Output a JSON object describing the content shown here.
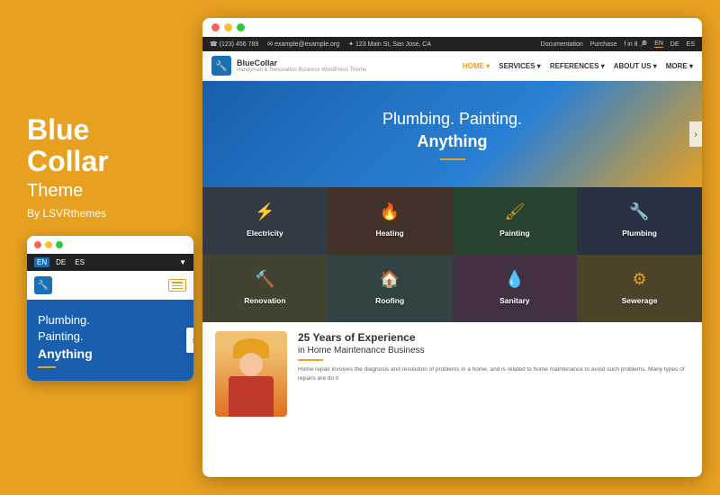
{
  "leftPanel": {
    "brandLine1": "Blue",
    "brandLine2": "Collar",
    "brandSubtitle": "Theme",
    "brandBy": "By LSVRthemes"
  },
  "mobile": {
    "heroText1": "Plumbing.",
    "heroText2": "Painting.",
    "heroText3": "Anything",
    "langTabs": [
      "EN",
      "DE",
      "ES"
    ]
  },
  "browser": {
    "topBar": {
      "phone": "☎ (123) 456 789",
      "email": "✉ example@example.org",
      "address": "✦ 123 Main St, San Jose, CA",
      "docLink": "Documentation",
      "purchaseLink": "Purchase",
      "langEN": "EN",
      "langDE": "DE",
      "langES": "ES"
    },
    "nav": {
      "logoName": "BlueCollar",
      "logoDesc": "Handyman & Renovation Business WordPress Theme",
      "menuItems": [
        {
          "label": "HOME",
          "active": true
        },
        {
          "label": "SERVICES"
        },
        {
          "label": "REFERENCES"
        },
        {
          "label": "ABOUT US"
        },
        {
          "label": "MORE"
        }
      ]
    },
    "hero": {
      "line1": "Plumbing. Painting.",
      "line2": "Anything"
    },
    "services": [
      {
        "id": "electricity",
        "label": "Electricity",
        "icon": "⚡",
        "bgClass": "service-bg-electricity"
      },
      {
        "id": "heating",
        "label": "Heating",
        "icon": "🔥",
        "bgClass": "service-bg-heating"
      },
      {
        "id": "painting",
        "label": "Painting",
        "icon": "🖌",
        "bgClass": "service-bg-painting"
      },
      {
        "id": "plumbing",
        "label": "Plumbing",
        "icon": "🔧",
        "bgClass": "service-bg-plumbing"
      },
      {
        "id": "renovation",
        "label": "Renovation",
        "icon": "🔨",
        "bgClass": "service-bg-renovation"
      },
      {
        "id": "roofing",
        "label": "Roofing",
        "icon": "🏠",
        "bgClass": "service-bg-roofing"
      },
      {
        "id": "sanitary",
        "label": "Sanitary",
        "icon": "💧",
        "bgClass": "service-bg-sanitary"
      },
      {
        "id": "sewerage",
        "label": "Sewerage",
        "icon": "⚙",
        "bgClass": "service-bg-sewerage"
      }
    ],
    "experience": {
      "title": "25 Years of Experience",
      "subtitle": "in Home Maintenance Business",
      "description": "Home repair involves the diagnosis and resolution of problems in a home, and is related to home maintenance to avoid such problems. Many types of repairs are do it"
    }
  },
  "colors": {
    "accent": "#E8A020",
    "primary": "#1a5fad",
    "dark": "#222222"
  }
}
